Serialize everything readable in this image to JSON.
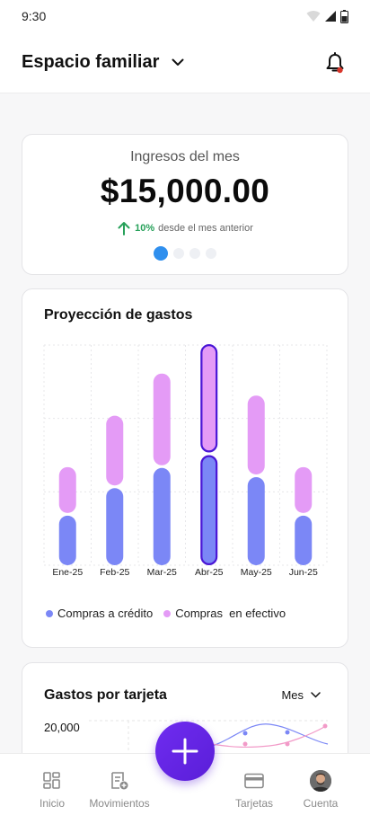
{
  "status": {
    "time": "9:30"
  },
  "header": {
    "title": "Espacio familiar"
  },
  "income": {
    "label": "Ingresos del mes",
    "amount": "$15,000.00",
    "delta_pct": "10%",
    "delta_text": "desde el mes anterior",
    "active_dot": 0,
    "dot_count": 4
  },
  "projection": {
    "title": "Proyección de gastos",
    "legend": [
      "Compras a crédito",
      "Compras  en efectivo"
    ]
  },
  "chart_data": {
    "type": "bar",
    "stacked": true,
    "categories": [
      "Ene-25",
      "Feb-25",
      "Mar-25",
      "Abr-25",
      "May-25",
      "Jun-25"
    ],
    "series": [
      {
        "name": "Compras a crédito",
        "values": [
          2.7,
          4.2,
          5.3,
          6.0,
          4.8,
          2.7
        ],
        "color": "#7b87f6"
      },
      {
        "name": "Compras  en efectivo",
        "values": [
          2.5,
          3.8,
          5.0,
          5.9,
          4.3,
          2.5
        ],
        "color": "#e49bf6"
      }
    ],
    "highlight_index": 3,
    "highlight_color": "#4a16d6",
    "ylim": [
      0,
      12
    ],
    "grid": true
  },
  "cards_section": {
    "title": "Gastos por tarjeta",
    "period": "Mes",
    "y_top_label": "20,000"
  },
  "nav": {
    "inicio": "Inicio",
    "movimientos": "Movimientos",
    "tarjetas": "Tarjetas",
    "cuenta": "Cuenta"
  },
  "colors": {
    "accent": "#2f8fee",
    "positive": "#27a15a",
    "fab": "#6f2cf0",
    "notification": "#d9362b"
  }
}
